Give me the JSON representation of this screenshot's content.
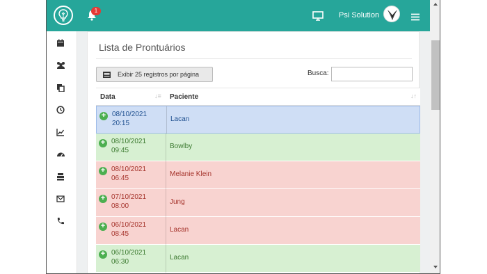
{
  "header": {
    "notification_count": "1",
    "user_name": "Psi Solution",
    "icons": [
      "logo-icon",
      "bell-icon",
      "monitor-icon",
      "hamburger-icon"
    ]
  },
  "sidebar": {
    "items": [
      {
        "icon": "calendar-icon"
      },
      {
        "icon": "users-icon"
      },
      {
        "icon": "files-icon"
      },
      {
        "icon": "clock-icon"
      },
      {
        "icon": "chart-icon"
      },
      {
        "icon": "dashboard-icon"
      },
      {
        "icon": "stack-icon"
      },
      {
        "icon": "mail-icon"
      },
      {
        "icon": "phone-icon"
      }
    ]
  },
  "main": {
    "title": "Lista de Prontuários",
    "show_button_label": "Exibir 25 registros por página",
    "search_label": "Busca:",
    "search_value": "",
    "columns": [
      "Data",
      "Paciente"
    ],
    "rows": [
      {
        "date": "08/10/2021",
        "time": "20:15",
        "patient": "Lacan",
        "status": "blue"
      },
      {
        "date": "08/10/2021",
        "time": "09:45",
        "patient": "Bowlby",
        "status": "green"
      },
      {
        "date": "08/10/2021",
        "time": "06:45",
        "patient": "Melanie Klein",
        "status": "red"
      },
      {
        "date": "07/10/2021",
        "time": "08:00",
        "patient": "Jung",
        "status": "red"
      },
      {
        "date": "06/10/2021",
        "time": "08:45",
        "patient": "Lacan",
        "status": "red"
      },
      {
        "date": "06/10/2021",
        "time": "06:30",
        "patient": "Lacan",
        "status": "green"
      }
    ]
  },
  "colors": {
    "topbar": "#26a69a",
    "row_blue": "#cfdef5",
    "row_green": "#d7f0d2",
    "row_red": "#f8d3d0",
    "add_icon": "#4caf50"
  }
}
